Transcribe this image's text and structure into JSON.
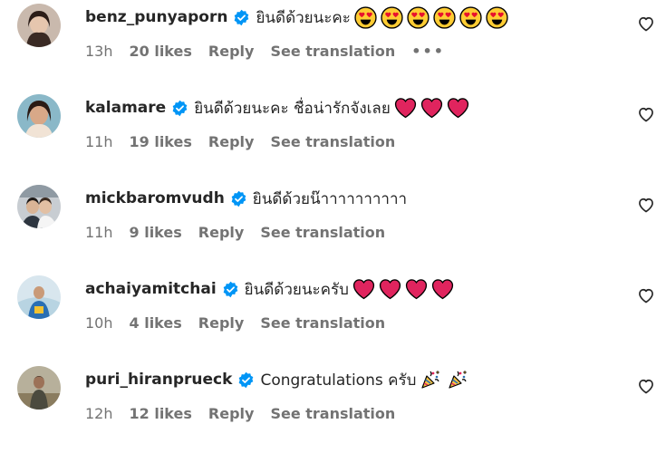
{
  "comments": [
    {
      "username": "benz_punyaporn",
      "text": "ยินดีด้วยนะคะ",
      "emoji_icons": [
        "heart-eyes-emoji-icon",
        "heart-eyes-emoji-icon",
        "heart-eyes-emoji-icon",
        "heart-eyes-emoji-icon",
        "heart-eyes-emoji-icon",
        "heart-eyes-emoji-icon"
      ],
      "time": "13h",
      "likes": "20 likes",
      "reply": "Reply",
      "translate": "See translation",
      "more": "•••"
    },
    {
      "username": "kalamare",
      "text": "ยินดีด้วยนะคะ ชื่อน่ารักจังเลย",
      "emoji_icons": [
        "red-heart-emoji-icon",
        "red-heart-emoji-icon",
        "red-heart-emoji-icon"
      ],
      "time": "11h",
      "likes": "19 likes",
      "reply": "Reply",
      "translate": "See translation"
    },
    {
      "username": "mickbaromvudh",
      "text": "ยินดีด้วยน๊าาาาาาาาาา",
      "emoji_icons": [],
      "time": "11h",
      "likes": "9 likes",
      "reply": "Reply",
      "translate": "See translation"
    },
    {
      "username": "achaiyamitchai",
      "text": "ยินดีด้วยนะครับ",
      "emoji_icons": [
        "red-heart-emoji-icon",
        "red-heart-emoji-icon",
        "red-heart-emoji-icon",
        "red-heart-emoji-icon"
      ],
      "time": "10h",
      "likes": "4 likes",
      "reply": "Reply",
      "translate": "See translation"
    },
    {
      "username": "puri_hiranprueck",
      "text": "Congratulations ครับ",
      "emoji_icons": [
        "party-popper-emoji-icon",
        "party-popper-emoji-icon"
      ],
      "time": "12h",
      "likes": "12 likes",
      "reply": "Reply",
      "translate": "See translation"
    }
  ],
  "colors": {
    "verified_blue": "#0095f6",
    "text": "#262626",
    "secondary": "#737373",
    "heart_red": "#e0245e"
  }
}
